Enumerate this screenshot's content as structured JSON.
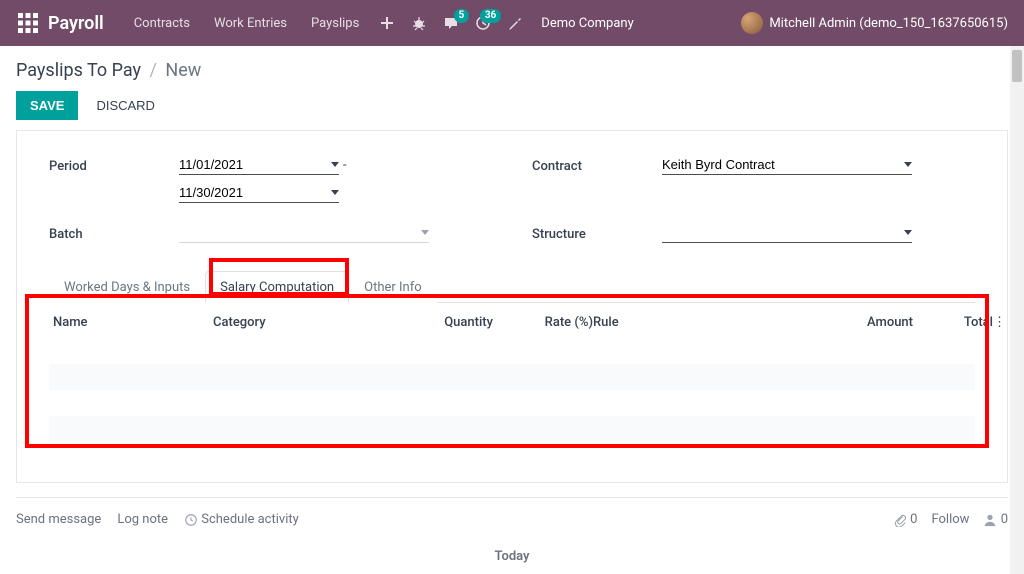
{
  "topbar": {
    "brand": "Payroll",
    "nav": [
      "Contracts",
      "Work Entries",
      "Payslips"
    ],
    "badge_msg": "5",
    "badge_act": "36",
    "company": "Demo Company",
    "user": "Mitchell Admin (demo_150_1637650615)"
  },
  "breadcrumb": {
    "parent": "Payslips To Pay",
    "current": "New"
  },
  "buttons": {
    "save": "SAVE",
    "discard": "DISCARD"
  },
  "form": {
    "period_label": "Period",
    "period_from": "11/01/2021",
    "period_to": "11/30/2021",
    "batch_label": "Batch",
    "batch": "",
    "contract_label": "Contract",
    "contract": "Keith Byrd Contract",
    "structure_label": "Structure",
    "structure": ""
  },
  "tabs": {
    "t1": "Worked Days & Inputs",
    "t2": "Salary Computation",
    "t3": "Other Info",
    "active": 1
  },
  "table": {
    "cols": {
      "name": "Name",
      "category": "Category",
      "quantity": "Quantity",
      "rate": "Rate (%)",
      "rule": "Rule",
      "amount": "Amount",
      "total": "Total"
    }
  },
  "chatter": {
    "send": "Send message",
    "log": "Log note",
    "schedule": "Schedule activity",
    "attach_count": "0",
    "follow": "Follow",
    "follower_count": "0",
    "today": "Today"
  }
}
